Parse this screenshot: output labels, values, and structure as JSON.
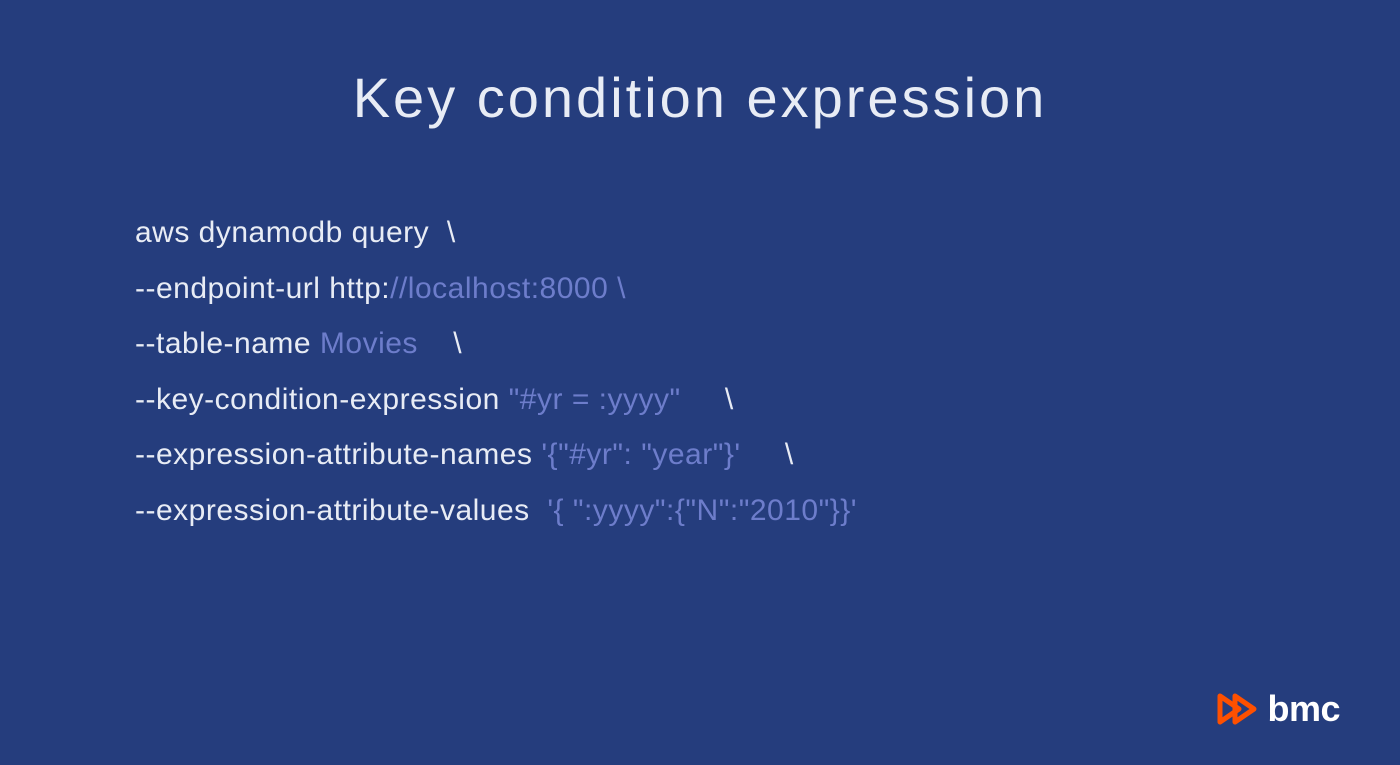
{
  "title": "Key condition expression",
  "code": {
    "line1_pre": "aws dynamodb query  \\",
    "line2_pre": "--endpoint-url http:",
    "line2_highlight": "//localhost:8000 \\",
    "line3_pre": "--table-name ",
    "line3_highlight": "Movies    ",
    "line3_post": "\\",
    "line4_pre": "--key-condition-expression ",
    "line4_highlight": "\"#yr = :yyyy\"     ",
    "line4_post": "\\",
    "line5_pre": "--expression-attribute-names ",
    "line5_highlight": "'{\"#yr\": \"year\"}'     ",
    "line5_post": "\\",
    "line6_pre": "--expression-attribute-values  ",
    "line6_highlight": "'{ \":yyyy\":{\"N\":\"2010\"}}'"
  },
  "logo": {
    "text": "bmc"
  }
}
